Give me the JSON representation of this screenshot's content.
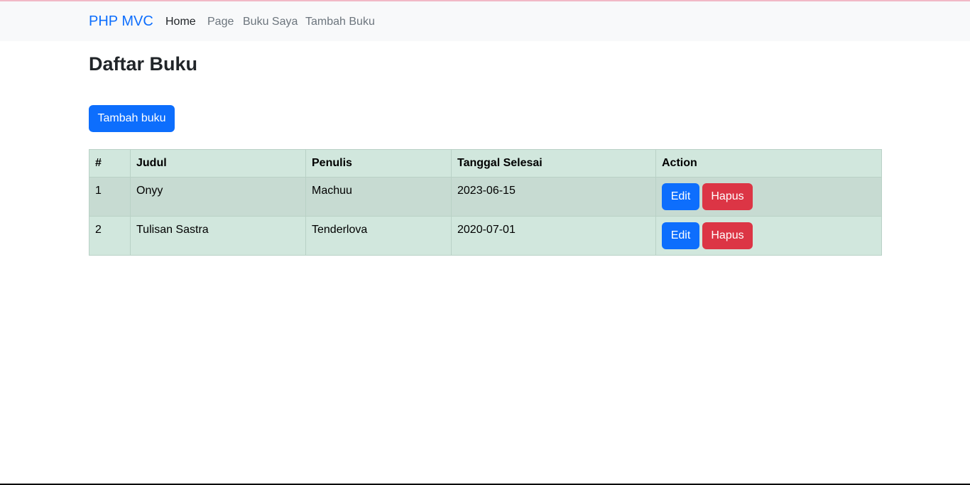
{
  "navbar": {
    "brand": "PHP MVC",
    "links": [
      {
        "label": "Home",
        "active": true
      },
      {
        "label": "Page",
        "active": false
      },
      {
        "label": "Buku Saya",
        "active": false
      },
      {
        "label": "Tambah Buku",
        "active": false
      }
    ]
  },
  "page": {
    "title": "Daftar Buku",
    "add_button": "Tambah buku"
  },
  "table": {
    "headers": [
      "#",
      "Judul",
      "Penulis",
      "Tanggal Selesai",
      "Action"
    ],
    "rows": [
      {
        "no": "1",
        "judul": "Onyy",
        "penulis": "Machuu",
        "tanggal": "2023-06-15",
        "edit": "Edit",
        "hapus": "Hapus"
      },
      {
        "no": "2",
        "judul": "Tulisan Sastra",
        "penulis": "Tenderlova",
        "tanggal": "2020-07-01",
        "edit": "Edit",
        "hapus": "Hapus"
      }
    ]
  },
  "colors": {
    "primary": "#0d6efd",
    "danger": "#dc3545",
    "table_success": "#d1e7dd",
    "navbar_bg": "#f8f9fa"
  }
}
